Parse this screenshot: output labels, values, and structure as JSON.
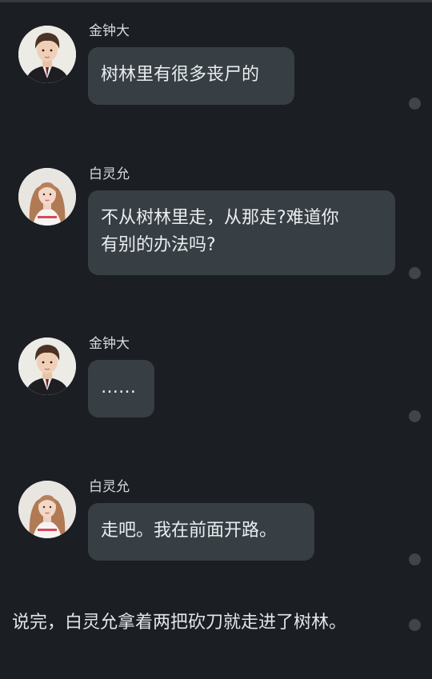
{
  "messages": [
    {
      "sender": "金钟大",
      "avatar_icon": "male-avatar-icon",
      "lines": [
        "树林里有很多丧尸的"
      ]
    },
    {
      "sender": "白灵允",
      "avatar_icon": "female-avatar-icon",
      "lines": [
        "不从树林里走，从那走?难道你",
        "有别的办法吗?"
      ]
    },
    {
      "sender": "金钟大",
      "avatar_icon": "male-avatar-icon",
      "lines": [
        "……"
      ]
    },
    {
      "sender": "白灵允",
      "avatar_icon": "female-avatar-icon",
      "lines": [
        "走吧。我在前面开路。"
      ]
    }
  ],
  "narration": "说完，白灵允拿着两把砍刀就走进了树林。",
  "colors": {
    "background": "#1b1e22",
    "bubble": "#383f44",
    "indicator_dot": "#3f464b",
    "text": "#e9edf0"
  }
}
